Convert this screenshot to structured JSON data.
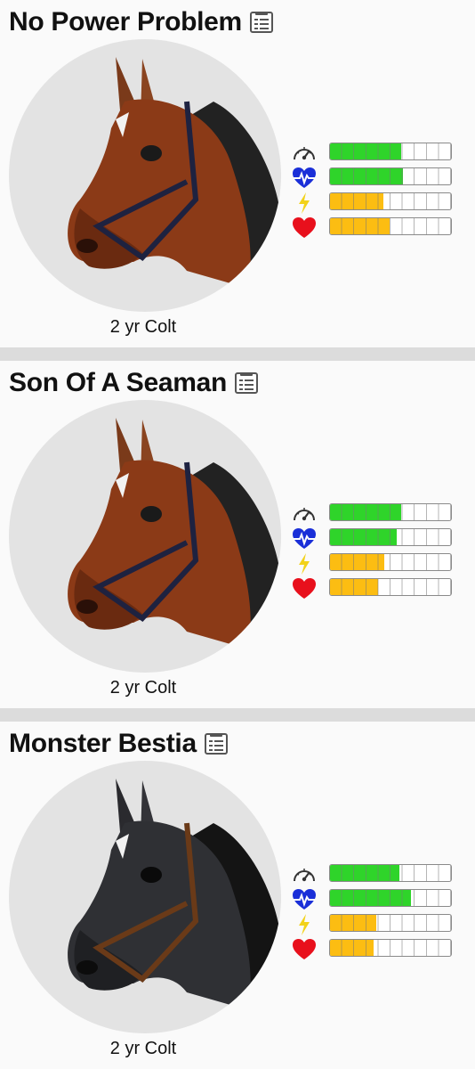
{
  "horses": [
    {
      "name": "No Power Problem",
      "age_label": "2 yr Colt",
      "coat": "bay",
      "stats": {
        "speed": 0.59,
        "stamina": 0.6,
        "energy": 0.44,
        "health": 0.49
      }
    },
    {
      "name": "Son Of A Seaman",
      "age_label": "2 yr Colt",
      "coat": "bay",
      "stats": {
        "speed": 0.59,
        "stamina": 0.55,
        "energy": 0.45,
        "health": 0.4
      }
    },
    {
      "name": "Monster Bestia",
      "age_label": "2 yr Colt",
      "coat": "black",
      "stats": {
        "speed": 0.57,
        "stamina": 0.67,
        "energy": 0.38,
        "health": 0.36
      }
    }
  ],
  "icons": {
    "note": "notes-icon",
    "speed": "speedometer-icon",
    "stamina": "heartbeat-icon",
    "energy": "lightning-bolt-icon",
    "health": "heart-icon"
  },
  "colors": {
    "speed_stamina_fill": "#2fd42a",
    "energy_health_fill": "#fcbd12",
    "stamina_icon": "#1a2fd8",
    "energy_icon": "#f2d21a",
    "health_icon": "#e8101c"
  }
}
